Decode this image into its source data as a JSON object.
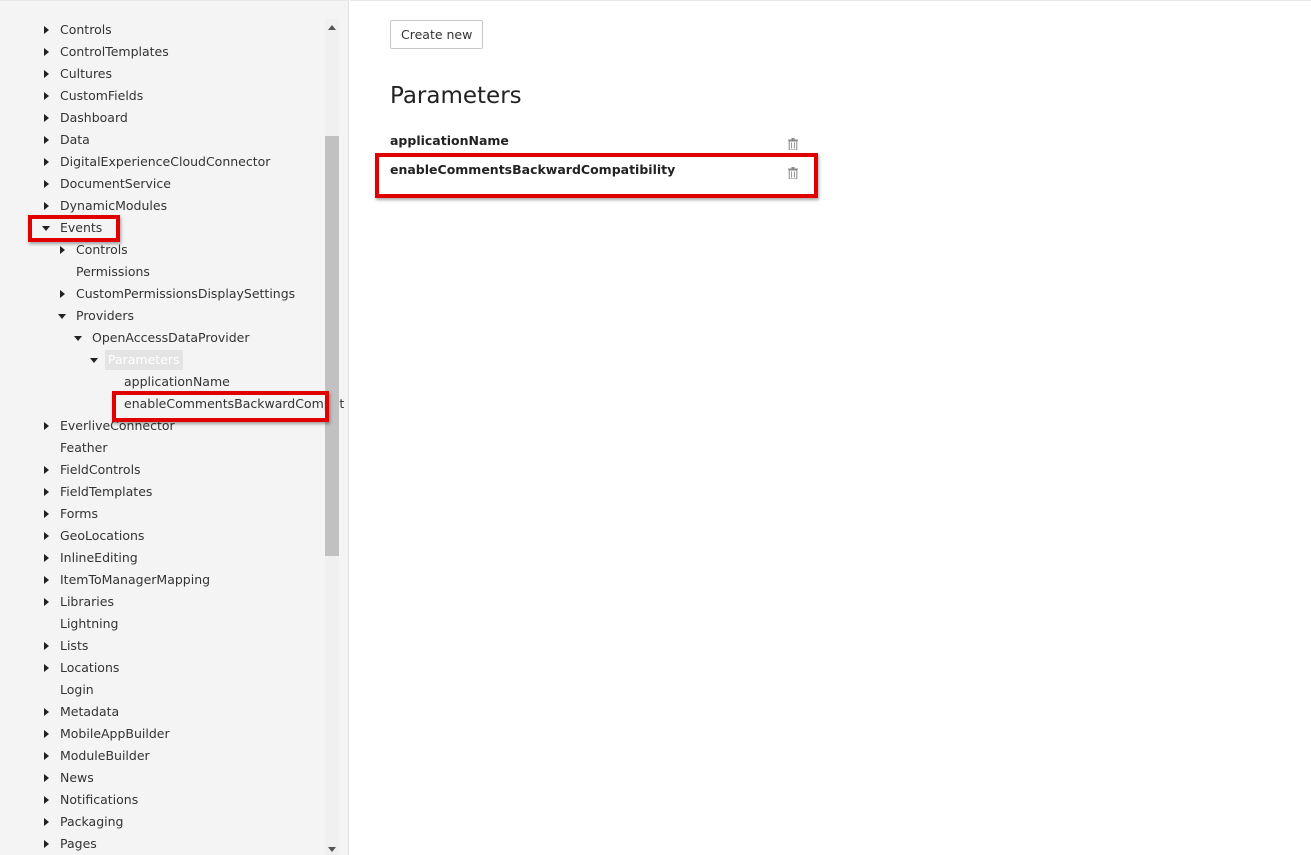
{
  "sidebar": {
    "tree": [
      {
        "label": "Controls",
        "level": 0,
        "arrow": "right"
      },
      {
        "label": "ControlTemplates",
        "level": 0,
        "arrow": "right"
      },
      {
        "label": "Cultures",
        "level": 0,
        "arrow": "right"
      },
      {
        "label": "CustomFields",
        "level": 0,
        "arrow": "right"
      },
      {
        "label": "Dashboard",
        "level": 0,
        "arrow": "right"
      },
      {
        "label": "Data",
        "level": 0,
        "arrow": "right"
      },
      {
        "label": "DigitalExperienceCloudConnector",
        "level": 0,
        "arrow": "right"
      },
      {
        "label": "DocumentService",
        "level": 0,
        "arrow": "right"
      },
      {
        "label": "DynamicModules",
        "level": 0,
        "arrow": "right"
      },
      {
        "label": "Events",
        "level": 0,
        "arrow": "down"
      },
      {
        "label": "Controls",
        "level": 1,
        "arrow": "right"
      },
      {
        "label": "Permissions",
        "level": 1,
        "arrow": "none"
      },
      {
        "label": "CustomPermissionsDisplaySettings",
        "level": 1,
        "arrow": "right"
      },
      {
        "label": "Providers",
        "level": 1,
        "arrow": "down"
      },
      {
        "label": "OpenAccessDataProvider",
        "level": 2,
        "arrow": "down"
      },
      {
        "label": "Parameters",
        "level": 3,
        "arrow": "down",
        "selected": true
      },
      {
        "label": "applicationName",
        "level": 4,
        "arrow": "none"
      },
      {
        "label": "enableCommentsBackwardCompat",
        "level": 4,
        "arrow": "none"
      },
      {
        "label": "EverliveConnector",
        "level": 0,
        "arrow": "right"
      },
      {
        "label": "Feather",
        "level": 0,
        "arrow": "none"
      },
      {
        "label": "FieldControls",
        "level": 0,
        "arrow": "right"
      },
      {
        "label": "FieldTemplates",
        "level": 0,
        "arrow": "right"
      },
      {
        "label": "Forms",
        "level": 0,
        "arrow": "right"
      },
      {
        "label": "GeoLocations",
        "level": 0,
        "arrow": "right"
      },
      {
        "label": "InlineEditing",
        "level": 0,
        "arrow": "right"
      },
      {
        "label": "ItemToManagerMapping",
        "level": 0,
        "arrow": "right"
      },
      {
        "label": "Libraries",
        "level": 0,
        "arrow": "right"
      },
      {
        "label": "Lightning",
        "level": 0,
        "arrow": "none"
      },
      {
        "label": "Lists",
        "level": 0,
        "arrow": "right"
      },
      {
        "label": "Locations",
        "level": 0,
        "arrow": "right"
      },
      {
        "label": "Login",
        "level": 0,
        "arrow": "none"
      },
      {
        "label": "Metadata",
        "level": 0,
        "arrow": "right"
      },
      {
        "label": "MobileAppBuilder",
        "level": 0,
        "arrow": "right"
      },
      {
        "label": "ModuleBuilder",
        "level": 0,
        "arrow": "right"
      },
      {
        "label": "News",
        "level": 0,
        "arrow": "right"
      },
      {
        "label": "Notifications",
        "level": 0,
        "arrow": "right"
      },
      {
        "label": "Packaging",
        "level": 0,
        "arrow": "right"
      },
      {
        "label": "Pages",
        "level": 0,
        "arrow": "right"
      }
    ]
  },
  "main": {
    "create_new_label": "Create new",
    "title": "Parameters",
    "parameters": [
      {
        "name": "applicationName"
      },
      {
        "name": "enableCommentsBackwardCompatibility"
      }
    ]
  },
  "colors": {
    "highlight": "#e00000",
    "sidebar_bg": "#f4f4f4"
  }
}
